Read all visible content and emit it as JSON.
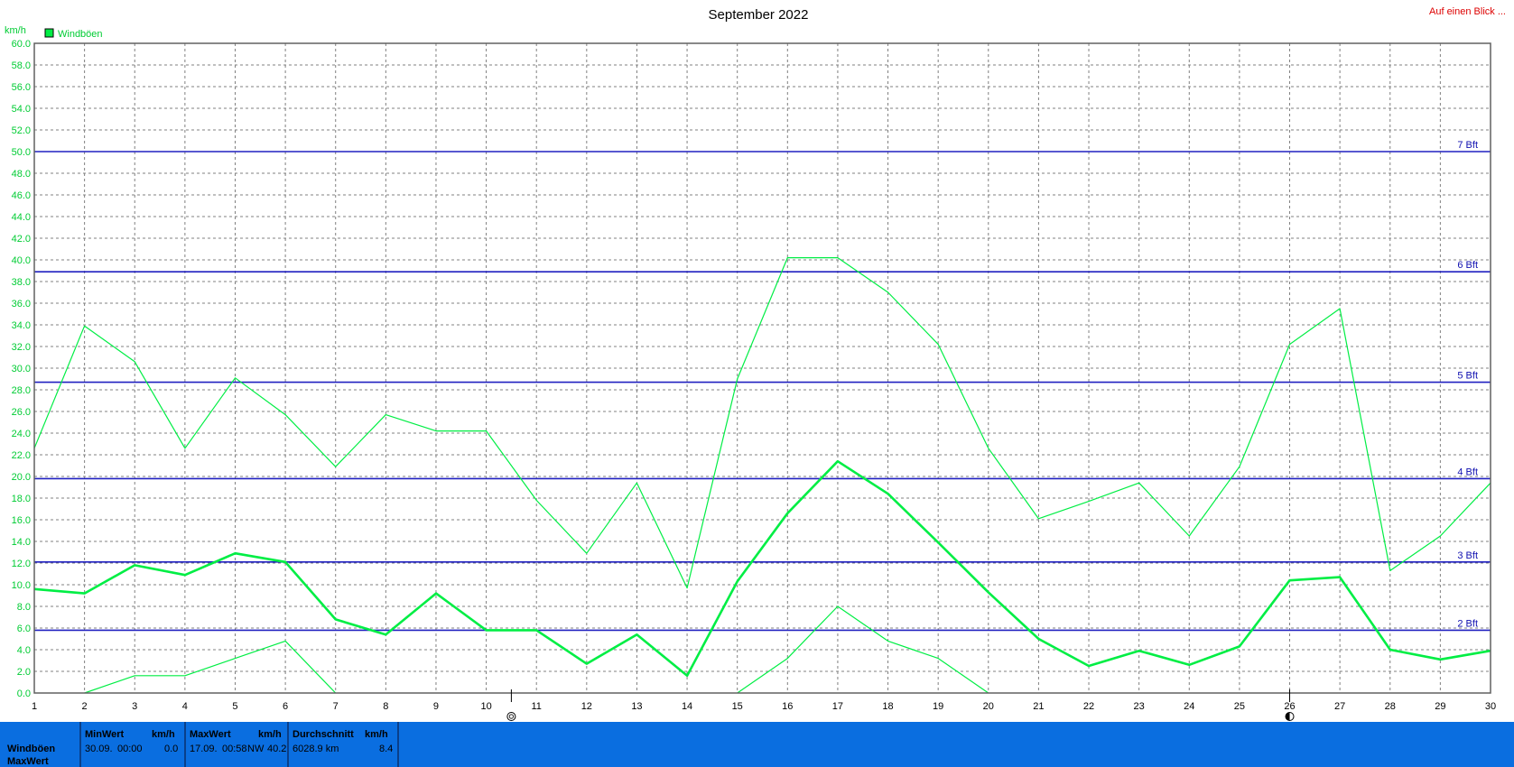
{
  "header": {
    "title": "September 2022",
    "top_right_link": "Auf einen Blick ...",
    "y_unit": "km/h",
    "legend_label": "Windböen"
  },
  "colors": {
    "series": "#00ee44",
    "bft_lines": "#2020c0",
    "bft_labels": "#1010b0",
    "link": "#dd0000",
    "footer_bg": "#0a6ee0"
  },
  "chart_data": {
    "type": "line",
    "title": "September 2022",
    "ylabel": "km/h",
    "ylim": [
      0,
      60
    ],
    "y_tick_step": 2,
    "x": [
      1,
      2,
      3,
      4,
      5,
      6,
      7,
      8,
      9,
      10,
      11,
      12,
      13,
      14,
      15,
      16,
      17,
      18,
      19,
      20,
      21,
      22,
      23,
      24,
      25,
      26,
      27,
      28,
      29,
      30
    ],
    "grid": true,
    "legend": "top-left",
    "series": [
      {
        "name": "Windböen",
        "role": "average",
        "values": [
          9.6,
          9.2,
          11.8,
          10.9,
          12.9,
          12.1,
          6.8,
          5.4,
          9.2,
          5.8,
          5.8,
          2.7,
          5.4,
          1.6,
          10.3,
          16.6,
          21.4,
          18.4,
          13.9,
          9.3,
          5.0,
          2.5,
          3.9,
          2.6,
          4.3,
          10.4,
          10.7,
          4.0,
          3.1,
          3.9
        ]
      },
      {
        "role": "maximum",
        "values": [
          22.6,
          33.9,
          30.6,
          22.6,
          29.1,
          25.7,
          20.9,
          25.7,
          24.2,
          24.2,
          17.8,
          12.9,
          19.4,
          9.7,
          29.0,
          40.2,
          40.2,
          37.0,
          32.2,
          22.6,
          16.1,
          17.7,
          19.4,
          14.5,
          20.9,
          32.2,
          35.5,
          11.3,
          14.5,
          19.4
        ]
      },
      {
        "role": "minimum",
        "values": [
          null,
          0.0,
          1.6,
          1.6,
          3.2,
          4.8,
          0.0,
          null,
          null,
          null,
          null,
          null,
          null,
          null,
          0.0,
          3.2,
          8.0,
          4.8,
          3.2,
          0.0,
          null,
          null,
          null,
          null,
          null,
          null,
          null,
          null,
          null,
          null
        ]
      }
    ],
    "beaufort_lines": [
      {
        "label": "2 Bft",
        "value": 5.8
      },
      {
        "label": "3 Bft",
        "value": 12.1
      },
      {
        "label": "4 Bft",
        "value": 19.8
      },
      {
        "label": "5 Bft",
        "value": 28.7
      },
      {
        "label": "6 Bft",
        "value": 38.9
      },
      {
        "label": "7 Bft",
        "value": 50.0
      }
    ],
    "moon_phases": [
      {
        "day": 10.5,
        "phase": "full",
        "icon": "full-moon-icon"
      },
      {
        "day": 26,
        "phase": "new",
        "icon": "new-moon-icon"
      }
    ]
  },
  "footer": {
    "row_label_1": "Windböen",
    "row_label_2": "MaxWert",
    "min_header": "MinWert",
    "min_unit": "km/h",
    "min_date": "30.09.",
    "min_time": "00:00",
    "min_value": "0.0",
    "max_header": "MaxWert",
    "max_unit": "km/h",
    "max_date": "17.09.",
    "max_time": "00:58",
    "max_dir": "NW",
    "max_value": "40.2",
    "avg_header": "Durchschnitt",
    "avg_unit": "km/h",
    "avg_distance": "6028.9 km",
    "avg_value": "8.4"
  }
}
